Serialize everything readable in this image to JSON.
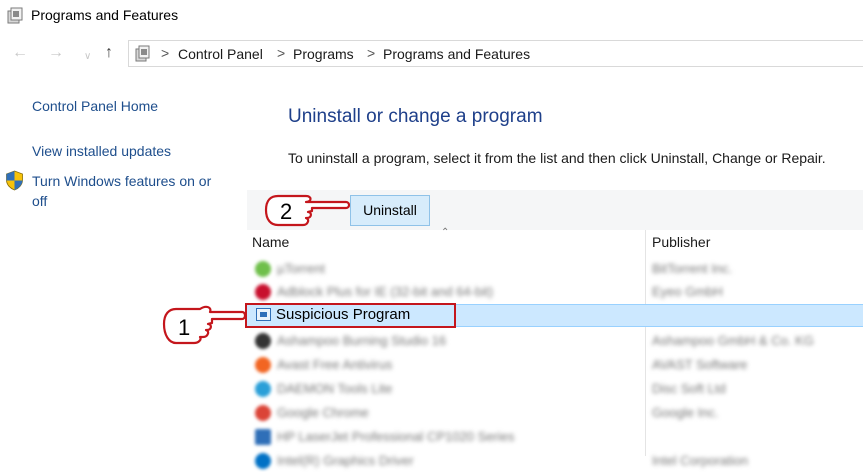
{
  "window": {
    "title": "Programs and Features"
  },
  "address_bar": {
    "crumbs": [
      "Control Panel",
      "Programs",
      "Programs and Features"
    ],
    "separator": ">"
  },
  "sidebar": {
    "items": [
      {
        "label": "Control Panel Home"
      },
      {
        "label": "View installed updates"
      },
      {
        "label": "Turn Windows features on or"
      },
      {
        "label": "off"
      }
    ]
  },
  "main": {
    "heading": "Uninstall or change a program",
    "description": "To uninstall a program, select it from the list and then click Uninstall, Change or Repair."
  },
  "toolbar": {
    "uninstall_label": "Uninstall"
  },
  "table": {
    "columns": [
      "Name",
      "Publisher"
    ],
    "rows": [
      {
        "name": "µTorrent",
        "publisher": "BitTorrent Inc.",
        "icon": "utorrent-icon",
        "color": "#6fbf4a"
      },
      {
        "name": "Adblock Plus for IE (32-bit and 64-bit)",
        "publisher": "Eyeo GmbH",
        "icon": "adblock-icon",
        "color": "#c8102e"
      },
      {
        "name": "Suspicious Program",
        "publisher": "",
        "icon": "program-icon",
        "color": "#2f6fb8",
        "selected": true
      },
      {
        "name": "Ashampoo Burning Studio 16",
        "publisher": "Ashampoo GmbH & Co. KG",
        "icon": "ashampoo-icon",
        "color": "#333333"
      },
      {
        "name": "Avast Free Antivirus",
        "publisher": "AVAST Software",
        "icon": "avast-icon",
        "color": "#f26522"
      },
      {
        "name": "DAEMON Tools Lite",
        "publisher": "Disc Soft Ltd",
        "icon": "daemon-icon",
        "color": "#2a9fd8"
      },
      {
        "name": "Google Chrome",
        "publisher": "Google Inc.",
        "icon": "chrome-icon",
        "color": "#db4437"
      },
      {
        "name": "HP LaserJet Professional CP1020 Series",
        "publisher": "",
        "icon": "printer-icon",
        "color": "#2f6fb8"
      },
      {
        "name": "Intel(R) Graphics Driver",
        "publisher": "Intel Corporation",
        "icon": "intel-icon",
        "color": "#0071c5"
      }
    ]
  },
  "annotations": {
    "callout_1": "1",
    "callout_2": "2"
  },
  "colors": {
    "link": "#1e4e8c",
    "heading": "#1e3f8a",
    "selection": "#cce8ff",
    "highlight_border": "#c4161c"
  }
}
